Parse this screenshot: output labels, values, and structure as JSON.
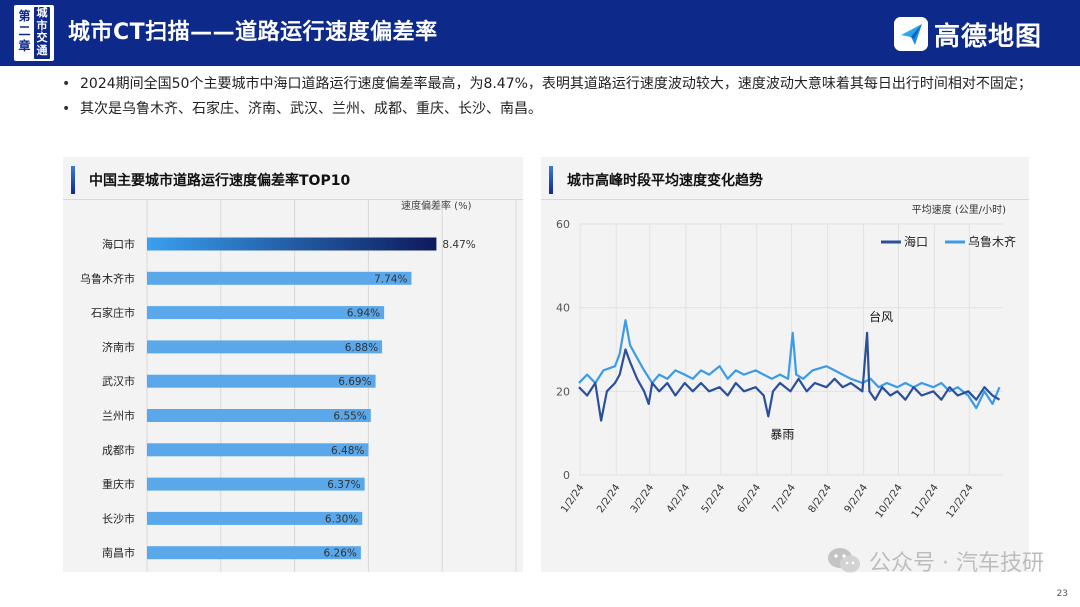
{
  "header": {
    "chapter_label": "第二章",
    "section_label": "城市交通",
    "title": "城市CT扫描——道路运行速度偏差率",
    "logo_text": "高德地图"
  },
  "bullets": [
    "2024期间全国50个主要城市中海口道路运行速度偏差率最高，为8.47%，表明其道路运行速度波动较大，速度波动大意味着其每日出行时间相对不固定；",
    "其次是乌鲁木齐、石家庄、济南、武汉、兰州、成都、重庆、长沙、南昌。"
  ],
  "left_panel": {
    "title": "中国主要城市道路运行速度偏差率TOP10"
  },
  "right_panel": {
    "title": "城市高峰时段平均速度变化趋势"
  },
  "chart_data": [
    {
      "type": "bar",
      "orientation": "horizontal",
      "title": "中国主要城市道路运行速度偏差率TOP10",
      "value_label": "速度偏差率 (%)",
      "categories": [
        "海口市",
        "乌鲁木齐市",
        "石家庄市",
        "济南市",
        "武汉市",
        "兰州市",
        "成都市",
        "重庆市",
        "长沙市",
        "南昌市"
      ],
      "values": [
        8.47,
        7.74,
        6.94,
        6.88,
        6.69,
        6.55,
        6.48,
        6.37,
        6.3,
        6.26
      ],
      "value_labels": [
        "8.47%",
        "7.74%",
        "6.94%",
        "6.88%",
        "6.69%",
        "6.55%",
        "6.48%",
        "6.37%",
        "6.30%",
        "6.26%"
      ],
      "xlim": [
        0,
        10.8
      ],
      "grid": true,
      "colors": {
        "highlight_start": "#3aa0ee",
        "highlight_end": "#0d1a5c",
        "bar": "#5aa8ea"
      }
    },
    {
      "type": "line",
      "title": "城市高峰时段平均速度变化趋势",
      "ylabel": "平均速度 (公里/小时)",
      "ylim": [
        0,
        60
      ],
      "yticks": [
        0,
        20,
        40,
        60
      ],
      "x_tick_labels": [
        "1/2/24",
        "2/2/24",
        "3/2/24",
        "4/2/24",
        "5/2/24",
        "6/2/24",
        "7/2/24",
        "8/2/24",
        "9/2/24",
        "10/2/24",
        "11/2/24",
        "12/2/24"
      ],
      "legend_position": "top-right",
      "series": [
        {
          "name": "海口",
          "color": "#2b4f9a",
          "points": [
            [
              "2024-01-01",
              21
            ],
            [
              "2024-01-08",
              19
            ],
            [
              "2024-01-15",
              22
            ],
            [
              "2024-01-20",
              13
            ],
            [
              "2024-01-25",
              20
            ],
            [
              "2024-02-01",
              22
            ],
            [
              "2024-02-05",
              24
            ],
            [
              "2024-02-10",
              30
            ],
            [
              "2024-02-14",
              27
            ],
            [
              "2024-02-20",
              23
            ],
            [
              "2024-02-26",
              20
            ],
            [
              "2024-03-01",
              17
            ],
            [
              "2024-03-04",
              22
            ],
            [
              "2024-03-10",
              20
            ],
            [
              "2024-03-17",
              22
            ],
            [
              "2024-03-24",
              19
            ],
            [
              "2024-04-01",
              22
            ],
            [
              "2024-04-08",
              20
            ],
            [
              "2024-04-15",
              22
            ],
            [
              "2024-04-22",
              20
            ],
            [
              "2024-05-01",
              21
            ],
            [
              "2024-05-08",
              19
            ],
            [
              "2024-05-15",
              22
            ],
            [
              "2024-05-22",
              20
            ],
            [
              "2024-06-01",
              21
            ],
            [
              "2024-06-08",
              19
            ],
            [
              "2024-06-12",
              14
            ],
            [
              "2024-06-16",
              20
            ],
            [
              "2024-06-22",
              22
            ],
            [
              "2024-07-01",
              20
            ],
            [
              "2024-07-08",
              23
            ],
            [
              "2024-07-15",
              20
            ],
            [
              "2024-07-22",
              22
            ],
            [
              "2024-08-01",
              21
            ],
            [
              "2024-08-08",
              23
            ],
            [
              "2024-08-15",
              21
            ],
            [
              "2024-08-22",
              22
            ],
            [
              "2024-09-01",
              20
            ],
            [
              "2024-09-05",
              34
            ],
            [
              "2024-09-07",
              20
            ],
            [
              "2024-09-12",
              18
            ],
            [
              "2024-09-18",
              21
            ],
            [
              "2024-09-25",
              19
            ],
            [
              "2024-10-01",
              20
            ],
            [
              "2024-10-08",
              18
            ],
            [
              "2024-10-15",
              21
            ],
            [
              "2024-10-22",
              19
            ],
            [
              "2024-11-01",
              20
            ],
            [
              "2024-11-08",
              18
            ],
            [
              "2024-11-15",
              21
            ],
            [
              "2024-11-22",
              19
            ],
            [
              "2024-12-01",
              20
            ],
            [
              "2024-12-08",
              18
            ],
            [
              "2024-12-15",
              21
            ],
            [
              "2024-12-22",
              19
            ],
            [
              "2024-12-28",
              18
            ]
          ]
        },
        {
          "name": "乌鲁木齐",
          "color": "#3a9be8",
          "points": [
            [
              "2024-01-01",
              22
            ],
            [
              "2024-01-08",
              24
            ],
            [
              "2024-01-15",
              22
            ],
            [
              "2024-01-22",
              25
            ],
            [
              "2024-02-01",
              26
            ],
            [
              "2024-02-05",
              29
            ],
            [
              "2024-02-10",
              37
            ],
            [
              "2024-02-14",
              31
            ],
            [
              "2024-02-20",
              28
            ],
            [
              "2024-02-26",
              25
            ],
            [
              "2024-03-04",
              22
            ],
            [
              "2024-03-10",
              24
            ],
            [
              "2024-03-17",
              23
            ],
            [
              "2024-03-24",
              25
            ],
            [
              "2024-04-01",
              24
            ],
            [
              "2024-04-08",
              23
            ],
            [
              "2024-04-15",
              25
            ],
            [
              "2024-04-22",
              24
            ],
            [
              "2024-05-01",
              26
            ],
            [
              "2024-05-08",
              23
            ],
            [
              "2024-05-15",
              25
            ],
            [
              "2024-05-22",
              24
            ],
            [
              "2024-06-01",
              25
            ],
            [
              "2024-06-08",
              24
            ],
            [
              "2024-06-15",
              23
            ],
            [
              "2024-06-22",
              24
            ],
            [
              "2024-06-29",
              23
            ],
            [
              "2024-07-03",
              34
            ],
            [
              "2024-07-06",
              24
            ],
            [
              "2024-07-12",
              23
            ],
            [
              "2024-07-20",
              25
            ],
            [
              "2024-08-01",
              26
            ],
            [
              "2024-08-08",
              25
            ],
            [
              "2024-08-15",
              24
            ],
            [
              "2024-08-22",
              23
            ],
            [
              "2024-09-01",
              22
            ],
            [
              "2024-09-08",
              23
            ],
            [
              "2024-09-15",
              21
            ],
            [
              "2024-09-22",
              22
            ],
            [
              "2024-10-01",
              21
            ],
            [
              "2024-10-08",
              22
            ],
            [
              "2024-10-15",
              21
            ],
            [
              "2024-10-22",
              22
            ],
            [
              "2024-11-01",
              21
            ],
            [
              "2024-11-08",
              22
            ],
            [
              "2024-11-15",
              20
            ],
            [
              "2024-11-22",
              21
            ],
            [
              "2024-12-01",
              19
            ],
            [
              "2024-12-08",
              16
            ],
            [
              "2024-12-15",
              20
            ],
            [
              "2024-12-22",
              17
            ],
            [
              "2024-12-28",
              21
            ]
          ]
        }
      ],
      "annotations": [
        {
          "text": "台风",
          "date": "2024-09-05",
          "value": 34
        },
        {
          "text": "暴雨",
          "date": "2024-06-12",
          "value": 14
        }
      ],
      "grid": true
    }
  ],
  "page_number": "23",
  "watermark": "公众号 · 汽车技研"
}
